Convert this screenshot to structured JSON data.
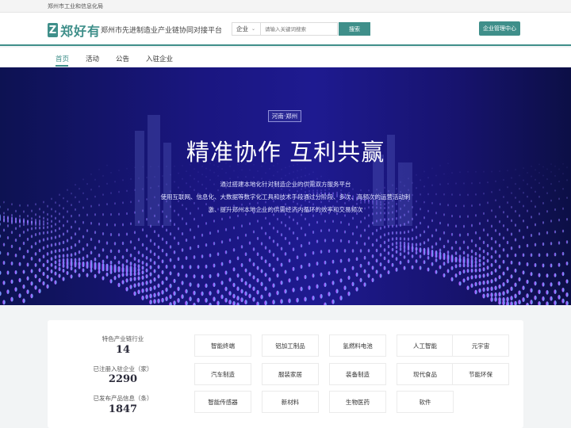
{
  "topbar": {
    "org": "郑州市工业和信息化局"
  },
  "header": {
    "logo_mark": "Z",
    "logo_text": "郑好有",
    "platform_name": "郑州市先进制造业产业链协同对接平台",
    "search": {
      "category": "企业",
      "placeholder": "请输入关键词搜索",
      "button": "搜索"
    },
    "manage_button": "企业管理中心"
  },
  "nav": {
    "items": [
      "首页",
      "活动",
      "公告",
      "入驻企业"
    ],
    "active": "首页"
  },
  "banner": {
    "region": "河南·郑州",
    "title": "精准协作 互利共赢",
    "lines": [
      "通过搭建本地化针对制造企业的供需双方服务平台",
      "使用互联网、信息化、大数据等数字化工具和技术手段通过分阶段、多次、高频次的运营活动刺",
      "激、提升郑州本地企业的供需经济内循环的效率和交易频次"
    ]
  },
  "stats": [
    {
      "label": "特色产业链行业",
      "value": "14"
    },
    {
      "label": "已注册入驻企业（家）",
      "value": "2290"
    },
    {
      "label": "已发布产品信息（条）",
      "value": "1847"
    }
  ],
  "industries": [
    [
      "智能终端",
      "铝加工制品",
      "氢燃料电池",
      "人工智能",
      "元宇宙"
    ],
    [
      "汽车制造",
      "服装家居",
      "装备制造",
      "现代食品",
      "节能环保"
    ],
    [
      "智能传感器",
      "新材料",
      "生物医药",
      "软件"
    ]
  ],
  "colors": {
    "brand": "#3f8f8a",
    "banner_dark": "#0d1252",
    "banner_mid": "#1e1a90"
  }
}
